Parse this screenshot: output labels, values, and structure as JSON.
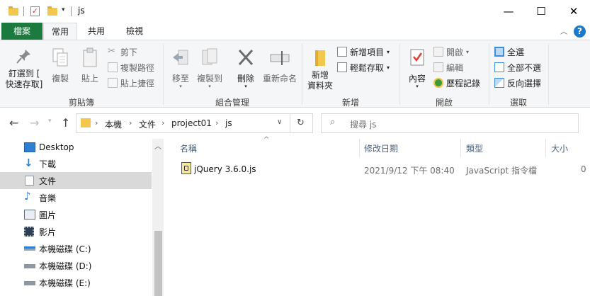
{
  "window": {
    "title": "js",
    "controls": {
      "minimize": "—",
      "maximize": "☐",
      "close": "✕"
    }
  },
  "ribbon_tabs": {
    "file": "檔案",
    "home": "常用",
    "share": "共用",
    "view": "檢視"
  },
  "ribbon": {
    "clipboard": {
      "label": "剪貼簿",
      "pin": "釘選到 [\n快速存取]",
      "pin_line1": "釘選到 [",
      "pin_line2": "快速存取]",
      "copy": "複製",
      "paste": "貼上",
      "cut": "剪下",
      "copy_path": "複製路徑",
      "paste_shortcut": "貼上捷徑"
    },
    "organize": {
      "label": "組合管理",
      "move_to": "移至",
      "copy_to": "複製到",
      "delete": "刪除",
      "rename": "重新命名"
    },
    "new": {
      "label": "新增",
      "new_folder_line1": "新增",
      "new_folder_line2": "資料夾",
      "new_item": "新增項目",
      "easy_access": "輕鬆存取"
    },
    "open": {
      "label": "開啟",
      "properties": "內容",
      "open": "開啟",
      "edit": "編輯",
      "history": "歷程記錄"
    },
    "select": {
      "label": "選取",
      "select_all": "全選",
      "select_none": "全部不選",
      "invert": "反向選擇"
    }
  },
  "address": {
    "breadcrumbs": [
      "本機",
      "文件",
      "project01",
      "js"
    ],
    "search_placeholder": "搜尋 js"
  },
  "nav_pane": {
    "items": [
      {
        "label": "Desktop",
        "icon": "desktop-icon"
      },
      {
        "label": "下載",
        "icon": "download-icon"
      },
      {
        "label": "文件",
        "icon": "documents-icon",
        "selected": true
      },
      {
        "label": "音樂",
        "icon": "music-icon"
      },
      {
        "label": "圖片",
        "icon": "pictures-icon"
      },
      {
        "label": "影片",
        "icon": "videos-icon"
      },
      {
        "label": "本機磁碟 (C:)",
        "icon": "drive-c-icon"
      },
      {
        "label": "本機磁碟 (D:)",
        "icon": "drive-icon"
      },
      {
        "label": "本機磁碟 (E:)",
        "icon": "drive-icon"
      }
    ]
  },
  "file_list": {
    "columns": [
      "名稱",
      "修改日期",
      "類型",
      "大小"
    ],
    "rows": [
      {
        "name": "jQuery 3.6.0.js",
        "modified": "2021/9/12 下午 08:40",
        "type": "JavaScript 指令檔",
        "size": "0"
      }
    ]
  },
  "colors": {
    "file_tab": "#1b7a3d",
    "accent": "#1979ca",
    "folder": "#f3c74e",
    "selected_nav": "#d9d9d9"
  }
}
